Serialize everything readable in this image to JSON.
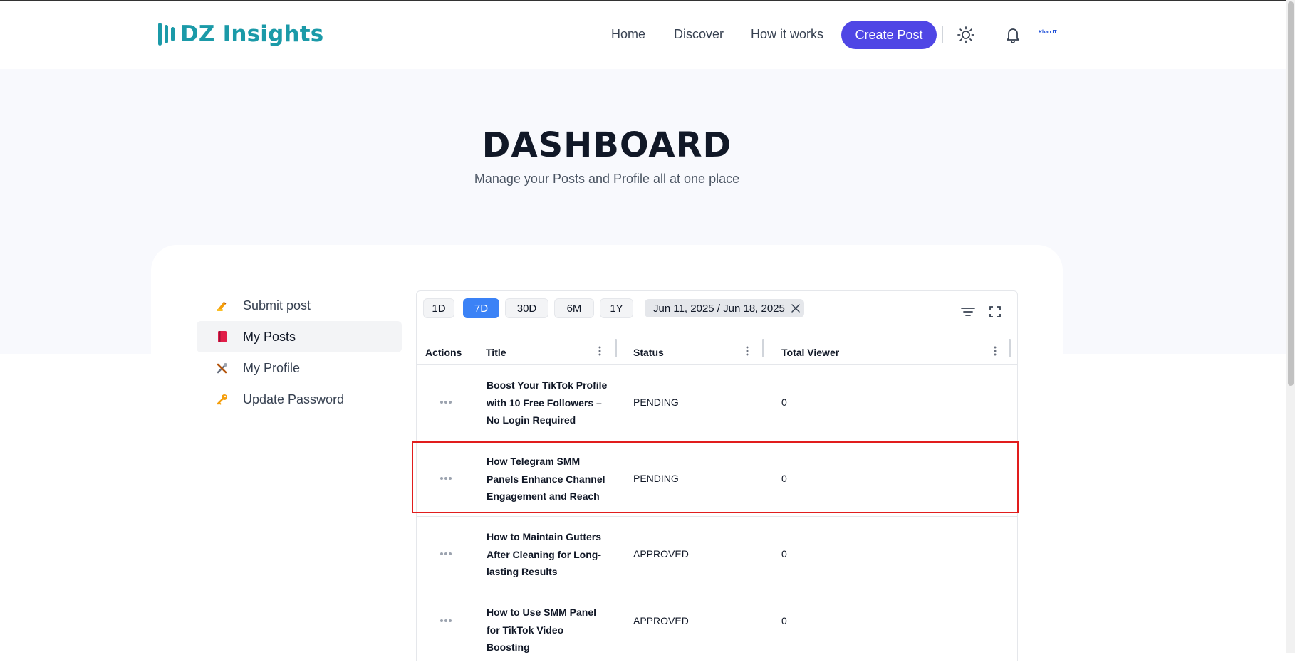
{
  "header": {
    "logo_text": "DZ Insights",
    "nav": {
      "home": "Home",
      "discover": "Discover",
      "how_it_works": "How it works"
    },
    "create_post_label": "Create Post",
    "avatar_text": "Khan IT"
  },
  "hero": {
    "title": "DASHBOARD",
    "subtitle": "Manage your Posts and Profile all at one place"
  },
  "sidebar": {
    "items": [
      {
        "label": "Submit post",
        "icon": "writing-hand-icon"
      },
      {
        "label": "My Posts",
        "icon": "book-icon",
        "active": true
      },
      {
        "label": "My Profile",
        "icon": "tools-icon"
      },
      {
        "label": "Update Password",
        "icon": "key-icon"
      }
    ]
  },
  "filters": {
    "ranges": [
      "1D",
      "7D",
      "30D",
      "6M",
      "1Y"
    ],
    "active_range": "7D",
    "date_range": "Jun 11, 2025 / Jun 18, 2025"
  },
  "table": {
    "columns": {
      "actions": "Actions",
      "title": "Title",
      "status": "Status",
      "total_viewer": "Total Viewer"
    },
    "rows": [
      {
        "title": "Boost Your TikTok Profile with 10 Free Followers – No Login Required",
        "status": "PENDING",
        "viewer": "0"
      },
      {
        "title": "How Telegram SMM Panels Enhance Channel Engagement and Reach",
        "status": "PENDING",
        "viewer": "0"
      },
      {
        "title": "How to Maintain Gutters After Cleaning for Long-lasting Results",
        "status": "APPROVED",
        "viewer": "0"
      },
      {
        "title": "How to Use SMM Panel for TikTok Video Boosting",
        "status": "APPROVED",
        "viewer": "0"
      }
    ]
  },
  "colors": {
    "brand": "#1b9aa8",
    "create_button": "#4f46e5",
    "active_chip": "#3b82f6",
    "highlight": "#e11d1d"
  }
}
